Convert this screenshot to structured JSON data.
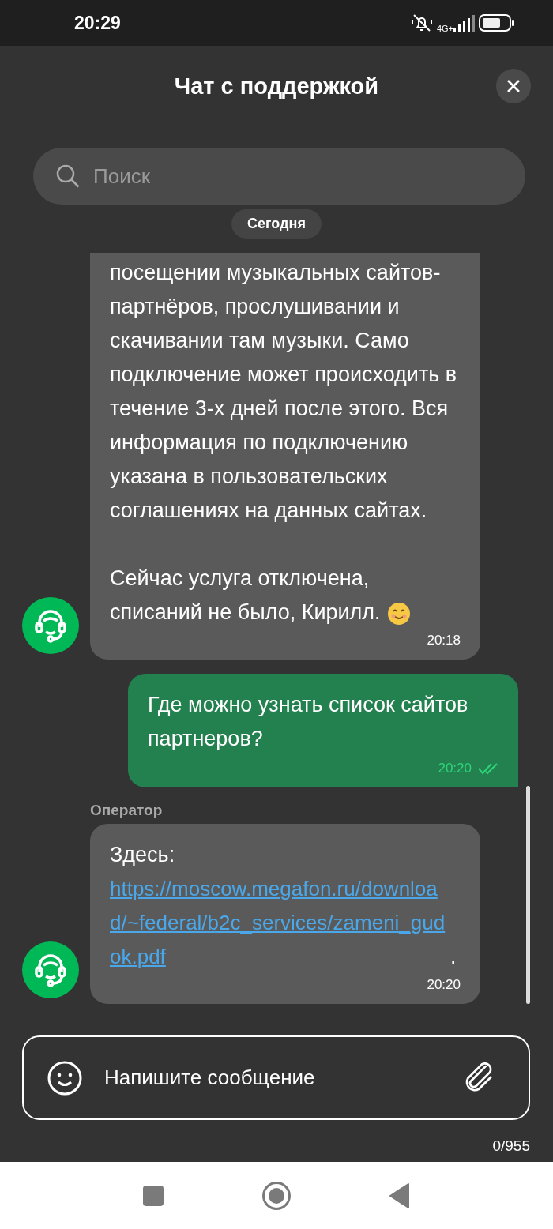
{
  "status_bar": {
    "time": "20:29",
    "network": "4G+"
  },
  "header": {
    "title": "Чат с поддержкой"
  },
  "search": {
    "placeholder": "Поиск"
  },
  "date_pill": "Сегодня",
  "messages": [
    {
      "kind": "incoming",
      "paragraphs": [
        "посещении музыкальных сайтов-партнёров, прослушивании и скачивании там музыки. Само подключение может происходить в течение 3-х дней после этого. Вся информация по подключению указана в пользовательских соглашениях на данных сайтах.",
        "Сейчас услуга отключена, списаний не было, Кирилл."
      ],
      "emoji": true,
      "time": "20:18"
    },
    {
      "kind": "outgoing",
      "paragraphs": [
        "Где можно узнать список сайтов партнеров?"
      ],
      "time": "20:20",
      "read": true
    },
    {
      "kind": "incoming",
      "sender": "Оператор",
      "prefix": "Здесь:",
      "link": "https://moscow.megafon.ru/download/~federal/b2c_services/zameni_gudok.pdf",
      "suffix": ".",
      "time": "20:20"
    }
  ],
  "composer": {
    "placeholder": "Напишите сообщение",
    "counter": "0/955"
  }
}
